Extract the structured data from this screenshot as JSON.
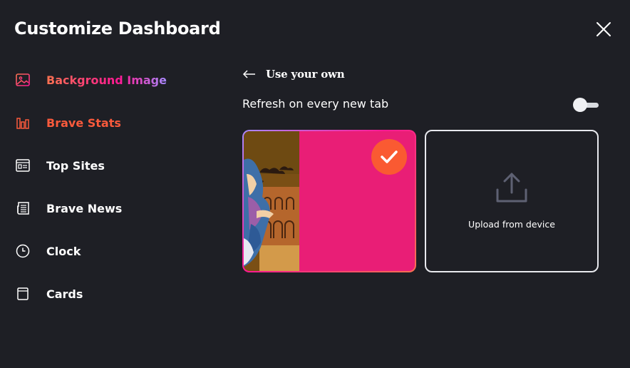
{
  "header": {
    "title": "Customize Dashboard",
    "close_icon": "close-icon"
  },
  "sidebar": {
    "items": [
      {
        "label": "Background Image",
        "icon": "image-icon",
        "state": "active"
      },
      {
        "label": "Brave Stats",
        "icon": "bar-chart-icon",
        "state": "highlighted"
      },
      {
        "label": "Top Sites",
        "icon": "top-sites-icon"
      },
      {
        "label": "Brave News",
        "icon": "news-icon"
      },
      {
        "label": "Clock",
        "icon": "clock-icon"
      },
      {
        "label": "Cards",
        "icon": "cards-icon"
      }
    ]
  },
  "panel": {
    "back_icon": "arrow-left-icon",
    "title": "Use your own",
    "refresh_label": "Refresh on every new tab",
    "refresh_enabled": false,
    "selected_image_icon": "checkmark-icon",
    "upload_label": "Upload from device",
    "upload_icon": "upload-icon"
  },
  "colors": {
    "background": "#1e1f25",
    "accent_orange": "#fa5a32",
    "accent_pink": "#e91e76",
    "accent_purple": "#a78aff"
  }
}
